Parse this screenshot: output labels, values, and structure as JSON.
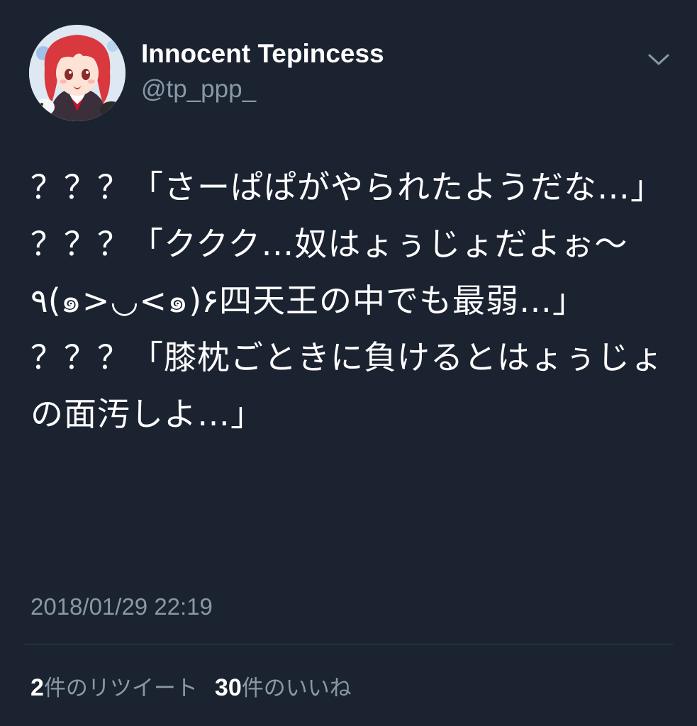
{
  "tweet": {
    "author": {
      "name": "Innocent Tepincess",
      "handle": "@tp_ppp_",
      "avatar_icon": "anime-girl-avatar"
    },
    "menu_icon": "chevron-down-icon",
    "text": "？？？「さーぱぱがやられたようだな…」\n？？？「ククク…奴はょぅじょだよぉ〜٩(๑>◡<๑)۶四天王の中でも最弱…」\n？？？「膝枕ごときに負けるとはょぅじょの面汚しよ…」",
    "timestamp": "2018/01/29 22:19",
    "stats": {
      "retweets": {
        "count": "2",
        "label": "件のリツイート"
      },
      "likes": {
        "count": "30",
        "label": "件のいいね"
      }
    }
  },
  "colors": {
    "background": "#1b2230",
    "text": "#ffffff",
    "secondary_text": "#8899a6",
    "divider": "#38444d"
  }
}
